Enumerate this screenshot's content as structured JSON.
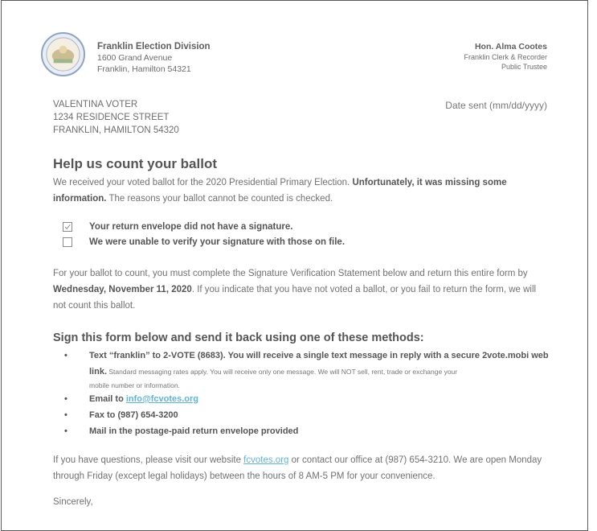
{
  "header": {
    "org_name": "Franklin Election Division",
    "org_address1": "1600 Grand Avenue",
    "org_address2": "Franklin, Hamilton 54321",
    "official_name": "Hon. Alma Cootes",
    "official_title1": "Franklin Clerk & Recorder",
    "official_title2": "Public Trustee"
  },
  "recipient": {
    "line1": "VALENTINA VOTER",
    "line2": "1234 RESIDENCE STREET",
    "line3": "FRANKLIN, HAMILTON 54320"
  },
  "date_sent_label": "Date sent (mm/dd/yyyy)",
  "title": "Help us count your ballot",
  "intro": {
    "part1": "We received your voted ballot for the 2020 Presidential Primary Election. ",
    "bold": "Unfortunately, it was missing some information.",
    "part2": " The reasons your ballot cannot be counted is checked."
  },
  "checks": [
    {
      "label": "Your return envelope did not have a signature.",
      "checked": true
    },
    {
      "label": "We were unable to verify your signature with those on file.",
      "checked": false
    }
  ],
  "instructions": {
    "part1": "For your ballot to count, you must complete the Signature Verification Statement below and return this entire form by ",
    "deadline": "Wednesday, November 11, 2020",
    "part2": ". If you indicate that you have not voted a ballot, or you fail to return the form, we will not count this ballot."
  },
  "methods_title": "Sign this form below and send it back using one of these methods:",
  "methods": {
    "text_bold": "Text “franklin” to 2-VOTE (8683). You will receive a single text message in reply with a secure 2vote.mobi web link.",
    "text_small1": " Standard messaging rates apply. You will receive only one message. We will NOT sell, rent, trade or exchange your",
    "text_small2": "mobile number or information.",
    "email_prefix": "Email to ",
    "email": "info@fcvotes.org",
    "fax": "Fax to (987) 654-3200",
    "mail": "Mail in the postage-paid return envelope provided",
    "bullet": "•"
  },
  "questions": {
    "part1": "If you have questions, please visit our website ",
    "link": "fcvotes.org",
    "part2": " or contact our office at (987) 654-3210. We are open Monday through Friday (except legal holidays) between the hours of 8 AM-5 PM for your convenience."
  },
  "closing": "Sincerely,",
  "colors": {
    "link": "#5fb3d6",
    "seal_ring": "#8fa3c2",
    "seal_center": "#b9a27a"
  }
}
